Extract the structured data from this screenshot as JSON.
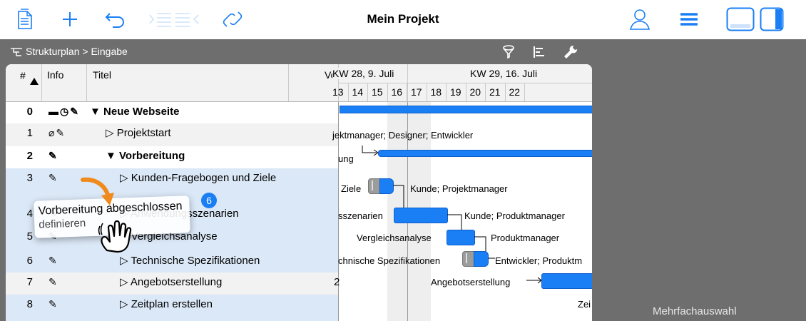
{
  "app": {
    "title": "Mein Projekt",
    "accent": "#1a7ff5"
  },
  "toolbar": {
    "left_icons": [
      "document-icon",
      "plus-icon",
      "undo-icon",
      "indent-icon",
      "link-icon"
    ],
    "right_icons": [
      "person-icon",
      "menu-icon",
      "bottom-panel-icon",
      "side-panel-icon"
    ]
  },
  "breadcrumb": {
    "text": "Strukturplan > Eingabe",
    "icons": [
      "structure-icon",
      "filter-icon",
      "gantt-icon",
      "wrench-icon"
    ]
  },
  "table": {
    "headers": {
      "num": "#",
      "info": "Info",
      "title": "Titel",
      "vo": "Vo"
    },
    "rows": [
      {
        "num": "0",
        "title": "▼ Neue Webseite",
        "info_icons": [
          "folder-icon",
          "clock-icon",
          "note-icon"
        ],
        "bold": true
      },
      {
        "num": "1",
        "title": "▷ Projektstart",
        "info_icons": [
          "paperclip-icon",
          "note-icon"
        ],
        "bold": false
      },
      {
        "num": "2",
        "title": "▼ Vorbereitung",
        "info_icons": [
          "note-icon"
        ],
        "bold": true
      },
      {
        "num": "3",
        "title": "▷ Kunden-Fragebogen und Ziele",
        "info_icons": [
          "note-icon"
        ],
        "bold": false
      },
      {
        "num": "4",
        "title": "▷ Anwendungsszenarien definieren",
        "info_icons": [
          "note-icon"
        ],
        "bold": false
      },
      {
        "num": "5",
        "title": "▷ Vergleichsanalyse",
        "info_icons": [
          "note-icon"
        ],
        "bold": false
      },
      {
        "num": "6",
        "title": "▷ Technische Spezifikationen",
        "info_icons": [
          "note-icon"
        ],
        "bold": false
      },
      {
        "num": "7",
        "title": "▷ Angebotserstellung",
        "info_icons": [
          "note-icon"
        ],
        "bold": false,
        "vo": "2"
      },
      {
        "num": "8",
        "title": "▷ Zeitplan erstellen",
        "info_icons": [
          "note-icon"
        ],
        "bold": false
      }
    ]
  },
  "gantt": {
    "week1": "KW 28, 9. Juli",
    "week2": "KW 29, 16. Juli",
    "days": [
      "13",
      "14",
      "15",
      "16",
      "17",
      "18",
      "19",
      "20",
      "21",
      "22"
    ],
    "labels": {
      "r1": "jektmanager; Designer; Entwickler",
      "r2": "ung",
      "r3a": "Ziele",
      "r3b": "Kunde; Projektmanager",
      "r4a": "sszenarien",
      "r4b": "Kunde; Produktmanager",
      "r5a": "Vergleichsanalyse",
      "r5b": "Produktmanager",
      "r6a": "chnische Spezifikationen",
      "r6b": "Entwickler; Produktm",
      "r7a": "Angebotserstellung",
      "r8": "Zei"
    }
  },
  "drag": {
    "label": "Vorbereitung abgeschlossen",
    "ghost_label": "definieren",
    "badge": "6"
  },
  "footer": {
    "multi_select": "Mehrfachauswahl"
  }
}
